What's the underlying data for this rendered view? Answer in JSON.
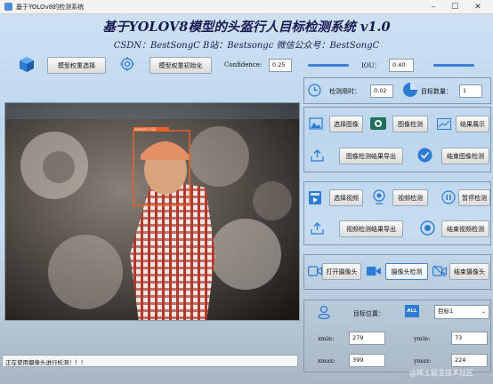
{
  "window": {
    "title": "基于YOLOv8的检测系统"
  },
  "header": {
    "title": "基于YOLOV8模型的头盔行人目标检测系统 v1.0",
    "subtitle": "CSDN：BestSongC   B站：Bestsongc   微信公众号：BestSongC"
  },
  "toolbar": {
    "select_weight_label": "模型权重选择",
    "init_weight_label": "模型权重初始化",
    "confidence_label": "Confidence:",
    "confidence_value": "0.25",
    "iou_label": "IOU：",
    "iou_value": "0.40"
  },
  "stats": {
    "time_label": "检测用时：",
    "time_value": "0.02",
    "count_label": "目标数量：",
    "count_value": "1"
  },
  "image_controls": {
    "select_image": "选择图像",
    "image_detect": "图像检测",
    "show_results": "结果展示",
    "export_image": "图像检测结果导出",
    "end_image": "结束图像检测"
  },
  "video_controls": {
    "select_video": "选择视频",
    "video_detect": "视频检测",
    "pause_detect": "暂停检测",
    "export_video": "视频检测结果导出",
    "end_video": "结束视频检测"
  },
  "camera_controls": {
    "open_camera": "打开摄像头",
    "camera_detect": "摄像头检测",
    "close_camera": "结束摄像头"
  },
  "target": {
    "position_label": "目标位置：",
    "all_badge": "ALL",
    "select_value": "目标1",
    "xmin_label": "xmin:",
    "xmin_value": "279",
    "ymin_label": "ymin:",
    "ymin_value": "73",
    "xmax_label": "xmax:",
    "xmax_value": "399",
    "ymax_label": "ymax:",
    "ymax_value": "224"
  },
  "detection": {
    "box_label": "helmet 0.83"
  },
  "status": {
    "text": "正在使用摄像头进行检测！！！"
  },
  "watermark": {
    "text": "@稀土掘金技术社区"
  },
  "colors": {
    "accent": "#2e7bd6",
    "box": "#e8632a",
    "title": "#1a1a50"
  }
}
